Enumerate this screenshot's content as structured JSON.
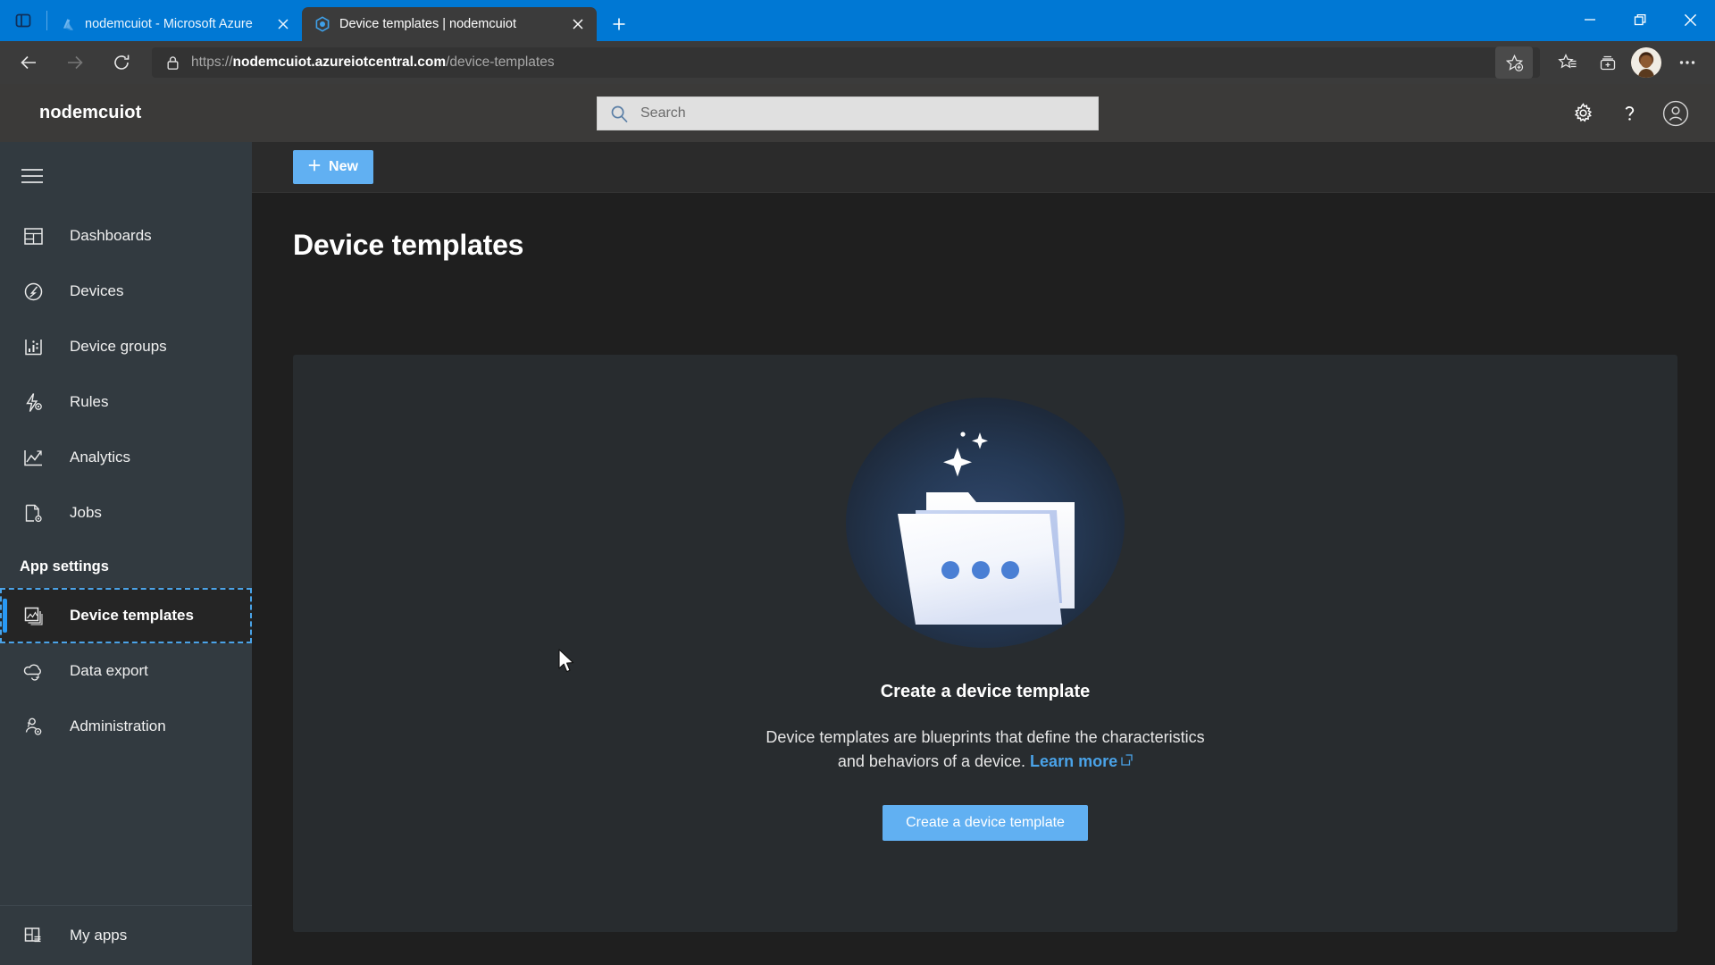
{
  "browser": {
    "tabs": [
      {
        "title": "nodemcuiot - Microsoft Azure",
        "favicon": "azure-logo-icon",
        "active": false
      },
      {
        "title": "Device templates | nodemcuiot",
        "favicon": "azure-iot-central-icon",
        "active": true
      }
    ],
    "new_tab_label": "+",
    "tab_search_icon": "tab-search-icon",
    "nav": {
      "back_icon": "back-arrow-icon",
      "forward_icon": "forward-arrow-icon",
      "reload_icon": "reload-icon"
    },
    "address_bar": {
      "lock_icon": "lock-icon",
      "scheme": "https://",
      "host": "nodemcuiot.azureiotcentral.com",
      "path": "/device-templates"
    },
    "toolbar_icons": [
      "add-favorite-icon",
      "favorites-icon",
      "collections-icon",
      "profile-avatar",
      "settings-and-more-icon"
    ],
    "window_controls": [
      "minimize-icon",
      "restore-icon",
      "close-icon"
    ]
  },
  "app_header": {
    "brand": "nodemcuiot",
    "search": {
      "value": "",
      "placeholder": "Search",
      "icon": "search-icon"
    },
    "actions": [
      "gear-icon",
      "help-icon",
      "account-icon"
    ]
  },
  "sidebar": {
    "hamburger_icon": "hamburger-menu-icon",
    "items": [
      {
        "label": "Dashboards",
        "icon": "dashboards-icon",
        "selected": false
      },
      {
        "label": "Devices",
        "icon": "devices-icon",
        "selected": false
      },
      {
        "label": "Device groups",
        "icon": "device-groups-icon",
        "selected": false
      },
      {
        "label": "Rules",
        "icon": "rules-icon",
        "selected": false
      },
      {
        "label": "Analytics",
        "icon": "analytics-icon",
        "selected": false
      },
      {
        "label": "Jobs",
        "icon": "jobs-icon",
        "selected": false
      }
    ],
    "section_label": "App settings",
    "settings_items": [
      {
        "label": "Device templates",
        "icon": "device-templates-icon",
        "selected": true
      },
      {
        "label": "Data export",
        "icon": "data-export-icon",
        "selected": false
      },
      {
        "label": "Administration",
        "icon": "administration-icon",
        "selected": false
      }
    ],
    "bottom_item": {
      "label": "My apps",
      "icon": "my-apps-icon"
    }
  },
  "main": {
    "command_bar": {
      "new_label": "New",
      "new_icon": "plus-icon"
    },
    "page_title": "Device templates",
    "empty_state": {
      "illustration": "folder-with-sparkles-illustration",
      "title": "Create a device template",
      "description_line1": "Device templates are blueprints that define the characteristics",
      "description_line2": "and behaviors of a device.",
      "learn_more_label": "Learn more",
      "learn_more_icon": "external-link-icon",
      "cta_label": "Create a device template"
    }
  },
  "colors": {
    "accent_blue": "#61b0f2",
    "browser_blue": "#0078d4",
    "link_blue": "#4aa3e8",
    "sidebar_bg": "#323a40",
    "panel_bg": "#282c2f",
    "page_bg": "#1f1f1f"
  }
}
